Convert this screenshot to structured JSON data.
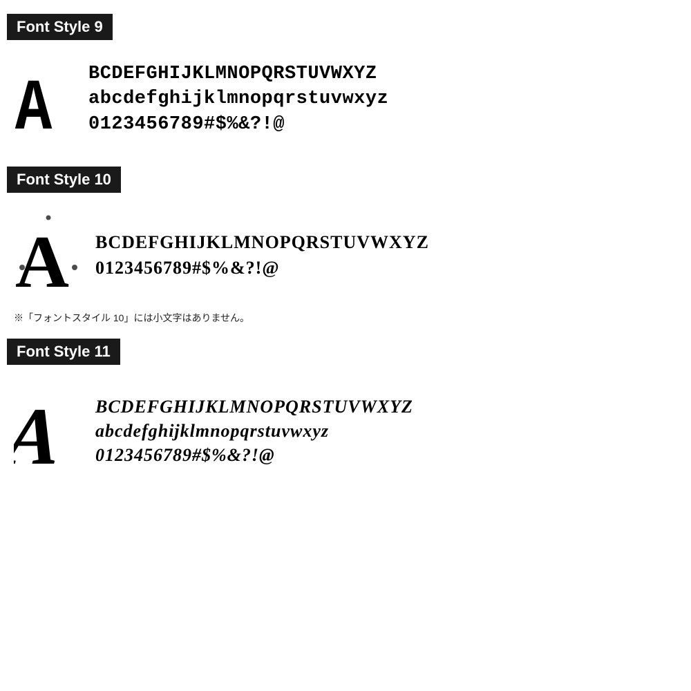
{
  "sections": [
    {
      "id": "style9",
      "label": "Font Style 9",
      "big_letter": "A",
      "lines": [
        "BCDEFGHIJKLMNOPQRSTUVWXYZ",
        "abcdefghijklmnopqrstuvwxyz",
        "0123456789#$%&?!@"
      ],
      "note": null
    },
    {
      "id": "style10",
      "label": "Font Style 10",
      "big_letter": "A",
      "lines": [
        "BCDEFGHIJKLMNOPQRSTUVWXYZ",
        "0123456789#$%&?!@"
      ],
      "note": "※「フォントスタイル 10」には小文字はありません。"
    },
    {
      "id": "style11",
      "label": "Font Style 11",
      "big_letter": "A",
      "lines": [
        "BCDEFGHIJKLMNOPQRSTUVWXYZ",
        "abcdefghijklmnopqrstuvwxyz",
        "0123456789#$%&?!@"
      ],
      "note": null
    }
  ]
}
